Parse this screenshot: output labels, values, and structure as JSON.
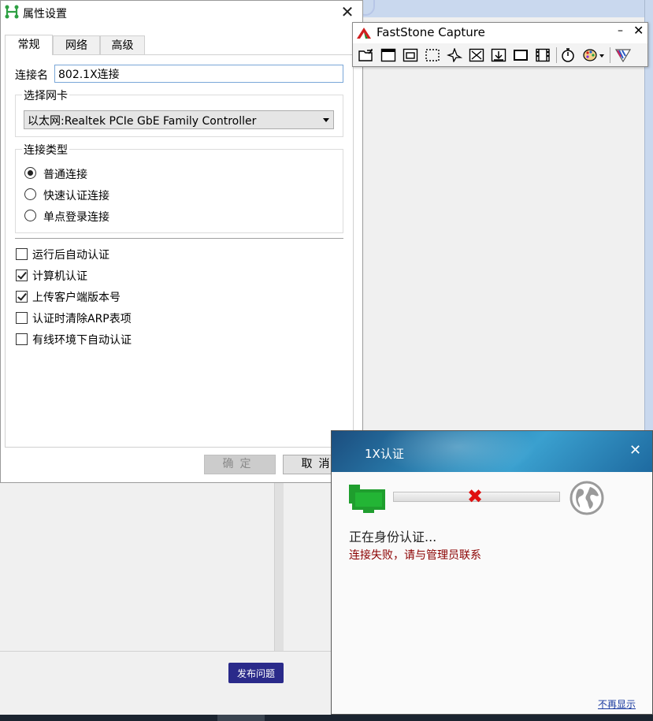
{
  "dialog": {
    "title": "属性设置",
    "close": "✕",
    "tabs": [
      {
        "label": "常规",
        "active": true
      },
      {
        "label": "网络",
        "active": false
      },
      {
        "label": "高级",
        "active": false
      }
    ],
    "connection_name_label": "连接名",
    "connection_name_value": "802.1X连接",
    "nic_group_title": "选择网卡",
    "nic_selected": "以太网:Realtek PCIe GbE Family Controller",
    "type_group_title": "连接类型",
    "connection_types": [
      {
        "label": "普通连接",
        "checked": true
      },
      {
        "label": "快速认证连接",
        "checked": false
      },
      {
        "label": "单点登录连接",
        "checked": false
      }
    ],
    "options": [
      {
        "label": "运行后自动认证",
        "checked": false
      },
      {
        "label": "计算机认证",
        "checked": true
      },
      {
        "label": "上传客户端版本号",
        "checked": true
      },
      {
        "label": "认证时清除ARP表项",
        "checked": false
      },
      {
        "label": "有线环境下自动认证",
        "checked": false
      }
    ],
    "ok_label": "确定",
    "cancel_label": "取消",
    "icon": "network-app-icon"
  },
  "faststone": {
    "title": "FastStone Capture",
    "minimize": "–",
    "close": "✕",
    "tools": [
      "open-file-icon",
      "capture-window-icon",
      "capture-object-icon",
      "capture-rectangle-icon",
      "capture-freehand-icon",
      "capture-fullscreen-icon",
      "capture-scrolling-icon",
      "capture-fixed-region-icon",
      "screen-recorder-icon",
      "delay-timer-icon",
      "output-options-icon",
      "settings-icon"
    ]
  },
  "auth_popup": {
    "title": "1X认证",
    "close": "✕",
    "status": "正在身份认证...",
    "error": "连接失败，请与管理员联系",
    "hide_link": "不再显示",
    "error_color": "#8b0000"
  },
  "background": {
    "publish_button": "发布问题"
  }
}
